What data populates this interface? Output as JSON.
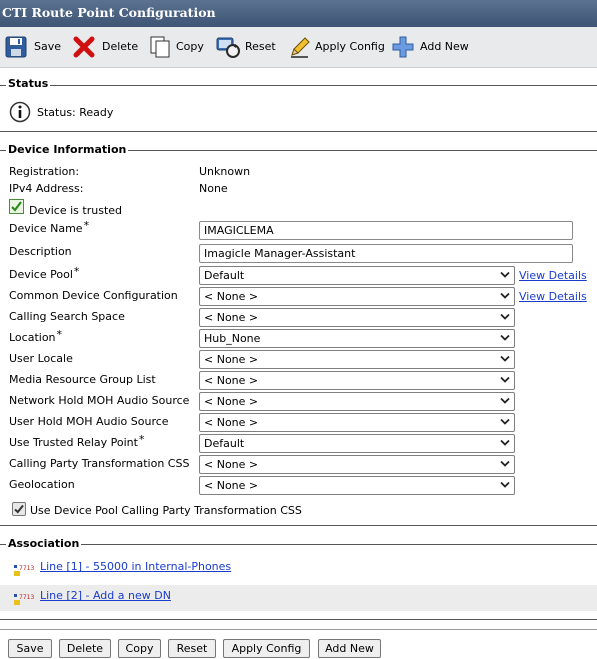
{
  "window": {
    "title": "CTI Route Point Configuration"
  },
  "toolbar": {
    "save": "Save",
    "delete": "Delete",
    "copy": "Copy",
    "reset": "Reset",
    "apply_config": "Apply Config",
    "add_new": "Add New"
  },
  "status": {
    "section_title": "Status",
    "text": "Status: Ready"
  },
  "device_info": {
    "section_title": "Device Information",
    "registration_label": "Registration:",
    "registration_value": "Unknown",
    "ipv4_label": "IPv4 Address:",
    "ipv4_value": "None",
    "trusted_label": "Device is trusted",
    "required_mark": "*",
    "view_details": "View Details",
    "device_name_label": "Device Name",
    "device_name_value": "IMAGICLEMA",
    "description_label": "Description",
    "description_value": "Imagicle Manager-Assistant",
    "device_pool_label": "Device Pool",
    "device_pool_value": "Default",
    "common_device_config_label": "Common Device Configuration",
    "common_device_config_value": "< None >",
    "calling_search_space_label": "Calling Search Space",
    "calling_search_space_value": "< None >",
    "location_label": "Location",
    "location_value": "Hub_None",
    "user_locale_label": "User Locale",
    "user_locale_value": "< None >",
    "media_resource_group_label": "Media Resource Group List",
    "media_resource_group_value": "< None >",
    "network_hold_moh_label": "Network Hold MOH Audio Source",
    "network_hold_moh_value": "< None >",
    "user_hold_moh_label": "User Hold MOH Audio Source",
    "user_hold_moh_value": "< None >",
    "trusted_relay_label": "Use Trusted Relay Point",
    "trusted_relay_value": "Default",
    "calling_party_css_label": "Calling Party Transformation CSS",
    "calling_party_css_value": "< None >",
    "geolocation_label": "Geolocation",
    "geolocation_value": "< None >",
    "use_device_pool_css_label": "Use Device Pool Calling Party Transformation CSS"
  },
  "association": {
    "section_title": "Association",
    "line_icon_text": "7713",
    "line1": "Line [1] - 55000 in Internal-Phones",
    "line2": "Line [2] - Add a new DN"
  },
  "buttons": {
    "save": "Save",
    "delete": "Delete",
    "copy": "Copy",
    "reset": "Reset",
    "apply_config": "Apply Config",
    "add_new": "Add New"
  }
}
